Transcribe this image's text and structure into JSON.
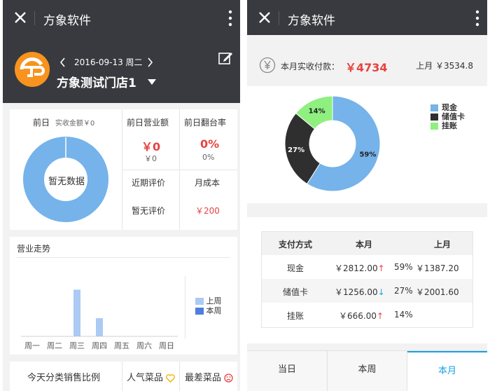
{
  "left": {
    "app_title": "方象软件",
    "date": "2016-09-13 周二",
    "store_name": "方象测试门店1",
    "prev_day": {
      "label": "前日",
      "sub": "实收金额￥0",
      "donut_center": "暂无数据"
    },
    "metrics": {
      "revenue_label": "前日营业额",
      "revenue_value": "￥0",
      "revenue_sub": "￥0",
      "turnover_label": "前日翻台率",
      "turnover_value": "0%",
      "turnover_sub": "0%",
      "review_label": "近期评价",
      "review_value": "暂无评价",
      "cost_label": "月成本",
      "cost_value": "￥200"
    },
    "trend": {
      "title": "营业走势",
      "legend_last": "上周",
      "legend_this": "本周"
    },
    "bottom": {
      "category_ratio": "今天分类销售比例",
      "popular": "人气菜品",
      "worst": "最差菜品"
    }
  },
  "right": {
    "app_title": "方象软件",
    "month_label": "本月实收付款：",
    "month_value": "￥4734",
    "last_month": "上月 ￥3534.8",
    "table": {
      "headers": [
        "支付方式",
        "本月",
        "",
        "上月"
      ],
      "rows": [
        {
          "method": "现金",
          "amount": "￥2812.00",
          "arrow": "↑",
          "pct": "59%",
          "last": "￥1387.20"
        },
        {
          "method": "储值卡",
          "amount": "￥1256.00",
          "arrow": "↓",
          "pct": "27%",
          "last": "￥2001.60"
        },
        {
          "method": "挂账",
          "amount": "￥666.00",
          "arrow": "↑",
          "pct": "14%",
          "last": ""
        }
      ]
    },
    "tabs": [
      "当日",
      "本周",
      "本月"
    ],
    "active_tab": 2
  },
  "colors": {
    "bar": "#393a3f",
    "accent_red": "#e64340",
    "blue": "#75b3ea",
    "dark": "#2f2f2f",
    "green": "#8ff07f",
    "tab_active": "#1aa1e6"
  },
  "chart_data": [
    {
      "type": "bar",
      "categories": [
        "周一",
        "周二",
        "周三",
        "周四",
        "周五",
        "周六",
        "周日"
      ],
      "series": [
        {
          "name": "上周",
          "values": [
            0,
            0,
            3.6,
            1.4,
            0,
            0,
            0
          ]
        },
        {
          "name": "本周",
          "values": [
            0,
            0,
            0,
            0,
            0,
            0,
            0
          ]
        }
      ],
      "title": "营业走势",
      "legend": "right"
    },
    {
      "type": "pie",
      "categories": [
        "现金",
        "储值卡",
        "挂账"
      ],
      "values": [
        59,
        27,
        14
      ],
      "labels": [
        "59%",
        "27%",
        "14%"
      ],
      "legend": "right"
    }
  ]
}
